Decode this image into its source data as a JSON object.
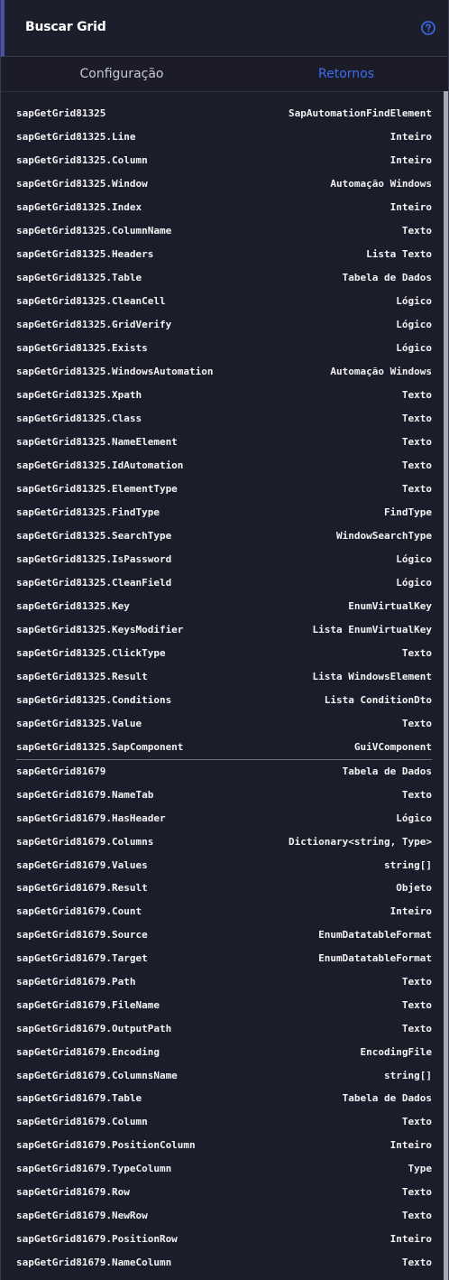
{
  "header": {
    "title": "Buscar Grid",
    "help_icon": "question-circle-icon"
  },
  "tabs": [
    {
      "label": "Configuração",
      "active": false
    },
    {
      "label": "Retornos",
      "active": true
    }
  ],
  "colors": {
    "accent": "#3d6cf2",
    "header_bar": "#4e4fa6",
    "background": "#1c1d2a"
  },
  "groups": [
    {
      "rows": [
        {
          "name": "sapGetGrid81325",
          "type": "SapAutomationFindElement"
        },
        {
          "name": "sapGetGrid81325.Line",
          "type": "Inteiro"
        },
        {
          "name": "sapGetGrid81325.Column",
          "type": "Inteiro"
        },
        {
          "name": "sapGetGrid81325.Window",
          "type": "Automação Windows"
        },
        {
          "name": "sapGetGrid81325.Index",
          "type": "Inteiro"
        },
        {
          "name": "sapGetGrid81325.ColumnName",
          "type": "Texto"
        },
        {
          "name": "sapGetGrid81325.Headers",
          "type": "Lista Texto"
        },
        {
          "name": "sapGetGrid81325.Table",
          "type": "Tabela de Dados"
        },
        {
          "name": "sapGetGrid81325.CleanCell",
          "type": "Lógico"
        },
        {
          "name": "sapGetGrid81325.GridVerify",
          "type": "Lógico"
        },
        {
          "name": "sapGetGrid81325.Exists",
          "type": "Lógico"
        },
        {
          "name": "sapGetGrid81325.WindowsAutomation",
          "type": "Automação Windows"
        },
        {
          "name": "sapGetGrid81325.Xpath",
          "type": "Texto"
        },
        {
          "name": "sapGetGrid81325.Class",
          "type": "Texto"
        },
        {
          "name": "sapGetGrid81325.NameElement",
          "type": "Texto"
        },
        {
          "name": "sapGetGrid81325.IdAutomation",
          "type": "Texto"
        },
        {
          "name": "sapGetGrid81325.ElementType",
          "type": "Texto"
        },
        {
          "name": "sapGetGrid81325.FindType",
          "type": "FindType"
        },
        {
          "name": "sapGetGrid81325.SearchType",
          "type": "WindowSearchType"
        },
        {
          "name": "sapGetGrid81325.IsPassword",
          "type": "Lógico"
        },
        {
          "name": "sapGetGrid81325.CleanField",
          "type": "Lógico"
        },
        {
          "name": "sapGetGrid81325.Key",
          "type": "EnumVirtualKey"
        },
        {
          "name": "sapGetGrid81325.KeysModifier",
          "type": "Lista EnumVirtualKey"
        },
        {
          "name": "sapGetGrid81325.ClickType",
          "type": "Texto"
        },
        {
          "name": "sapGetGrid81325.Result",
          "type": "Lista WindowsElement"
        },
        {
          "name": "sapGetGrid81325.Conditions",
          "type": "Lista ConditionDto"
        },
        {
          "name": "sapGetGrid81325.Value",
          "type": "Texto"
        },
        {
          "name": "sapGetGrid81325.SapComponent",
          "type": "GuiVComponent"
        }
      ]
    },
    {
      "rows": [
        {
          "name": "sapGetGrid81679",
          "type": "Tabela de Dados"
        },
        {
          "name": "sapGetGrid81679.NameTab",
          "type": "Texto"
        },
        {
          "name": "sapGetGrid81679.HasHeader",
          "type": "Lógico"
        },
        {
          "name": "sapGetGrid81679.Columns",
          "type": "Dictionary<string, Type>"
        },
        {
          "name": "sapGetGrid81679.Values",
          "type": "string[]"
        },
        {
          "name": "sapGetGrid81679.Result",
          "type": "Objeto"
        },
        {
          "name": "sapGetGrid81679.Count",
          "type": "Inteiro"
        },
        {
          "name": "sapGetGrid81679.Source",
          "type": "EnumDatatableFormat"
        },
        {
          "name": "sapGetGrid81679.Target",
          "type": "EnumDatatableFormat"
        },
        {
          "name": "sapGetGrid81679.Path",
          "type": "Texto"
        },
        {
          "name": "sapGetGrid81679.FileName",
          "type": "Texto"
        },
        {
          "name": "sapGetGrid81679.OutputPath",
          "type": "Texto"
        },
        {
          "name": "sapGetGrid81679.Encoding",
          "type": "EncodingFile"
        },
        {
          "name": "sapGetGrid81679.ColumnsName",
          "type": "string[]"
        },
        {
          "name": "sapGetGrid81679.Table",
          "type": "Tabela de Dados"
        },
        {
          "name": "sapGetGrid81679.Column",
          "type": "Texto"
        },
        {
          "name": "sapGetGrid81679.PositionColumn",
          "type": "Inteiro"
        },
        {
          "name": "sapGetGrid81679.TypeColumn",
          "type": "Type"
        },
        {
          "name": "sapGetGrid81679.Row",
          "type": "Texto"
        },
        {
          "name": "sapGetGrid81679.NewRow",
          "type": "Texto"
        },
        {
          "name": "sapGetGrid81679.PositionRow",
          "type": "Inteiro"
        },
        {
          "name": "sapGetGrid81679.NameColumn",
          "type": "Texto"
        }
      ]
    }
  ]
}
